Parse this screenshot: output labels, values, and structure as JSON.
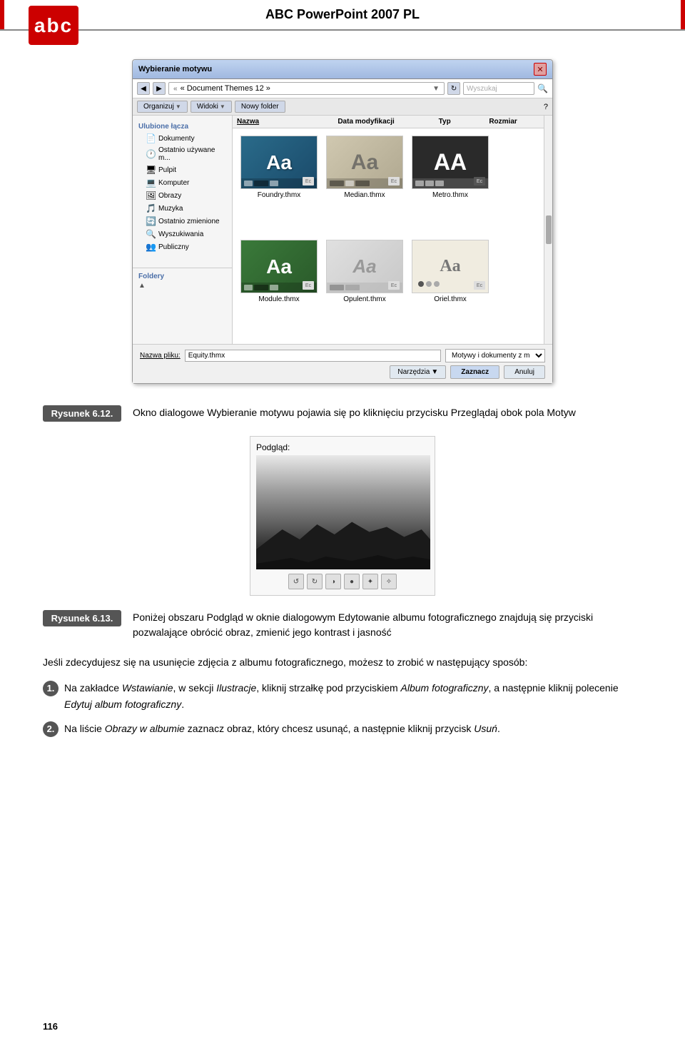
{
  "header": {
    "title": "ABC PowerPoint 2007 PL",
    "logo_text": "abc"
  },
  "dialog": {
    "title": "Wybieranie motywu",
    "breadcrumb": "« Document Themes 12 »",
    "search_placeholder": "Wyszukaj",
    "toolbar_buttons": [
      "Organizuj",
      "Widoki",
      "Nowy folder"
    ],
    "columns": {
      "name": "Nazwa",
      "date": "Data modyfikacji",
      "type": "Typ",
      "size": "Rozmiar"
    },
    "sidebar_sections": {
      "favorites_label": "Ulubione łącza",
      "favorites": [
        "Dokumenty",
        "Ostatnio używane m...",
        "Pulpit",
        "Komputer",
        "Obrazy",
        "Muzyka",
        "Ostatnio zmienione",
        "Wyszukiwania",
        "Publiczny"
      ],
      "folders_label": "Foldery"
    },
    "files": [
      {
        "name": "Foundry.thmx",
        "theme": "foundry"
      },
      {
        "name": "Median.thmx",
        "theme": "median"
      },
      {
        "name": "Metro.thmx",
        "theme": "metro"
      },
      {
        "name": "Module.thmx",
        "theme": "module"
      },
      {
        "name": "Opulent.thmx",
        "theme": "opulent"
      },
      {
        "name": "Oriel.thmx",
        "theme": "oriel"
      }
    ],
    "filename_label": "Nazwa pliku:",
    "filename_value": "Equity.thmx",
    "filetype_label": "Motywy i dokumenty z motywa...",
    "tools_btn": "Narzędzia",
    "open_btn": "Zaznacz",
    "cancel_btn": "Anuluj"
  },
  "figure_612": {
    "label": "Rysunek 6.12.",
    "caption": "Okno dialogowe Wybieranie motywu pojawia się po kliknięciu przycisku Przeglądaj obok pola Motyw"
  },
  "preview": {
    "label": "Podgląd:"
  },
  "figure_613": {
    "label": "Rysunek 6.13.",
    "caption": "Poniżej obszaru Podgląd w oknie dialogowym Edytowanie albumu fotograficznego znajdują się przyciski pozwalające obrócić obraz, zmienić jego kontrast i jasność"
  },
  "body_paragraph": "Jeśli zdecydujesz się na usunięcie zdjęcia z albumu fotograficznego, możesz to zrobić w następujący sposób:",
  "numbered_items": [
    {
      "number": "1.",
      "text": "Na zakładce Wstawianie, w sekcji Ilustracje, kliknij strzałkę pod przyciskiem Album fotograficzny, a następnie kliknij polecenie Edytuj album fotograficzny."
    },
    {
      "number": "2.",
      "text": "Na liście Obrazy w albumie zaznacz obraz, który chcesz usunąć, a następnie kliknij przycisk Usuń."
    }
  ],
  "page_number": "116"
}
